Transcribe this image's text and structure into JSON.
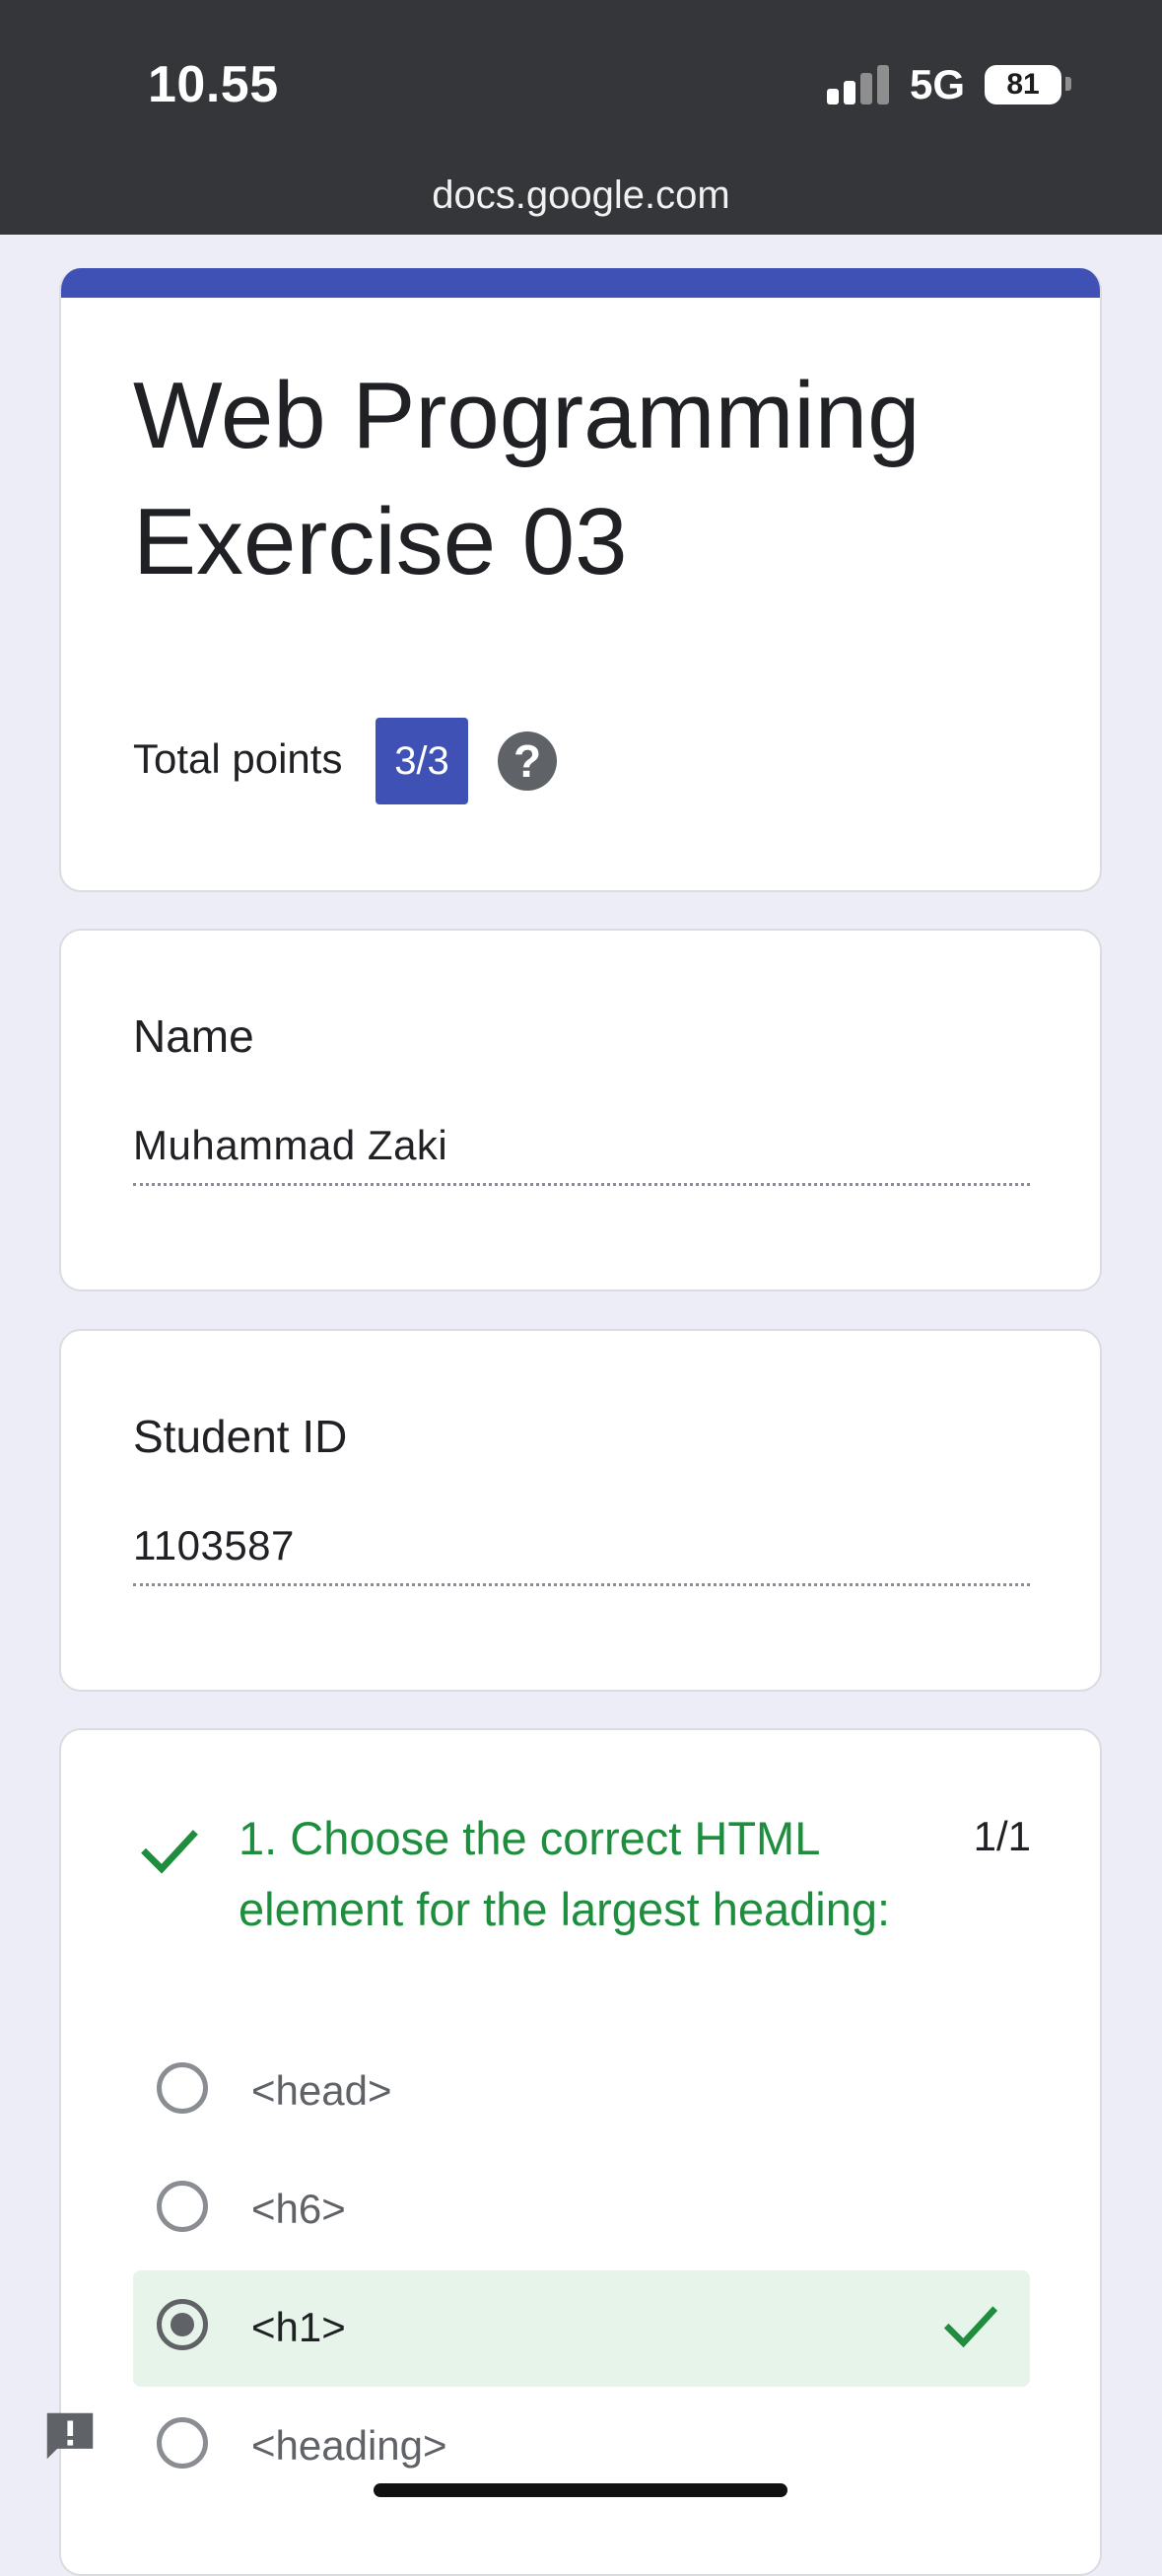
{
  "status_bar": {
    "time": "10.55",
    "network": "5G",
    "battery": "81",
    "icons": [
      "signal-icon",
      "battery-icon"
    ]
  },
  "browser": {
    "url": "docs.google.com"
  },
  "form": {
    "title": "Web Programming Exercise 03",
    "total_points_label": "Total points",
    "total_points": "3/3",
    "help_label": "?",
    "accent_color": "#3f51b5"
  },
  "fields": [
    {
      "label": "Name",
      "value": "Muhammad Zaki"
    },
    {
      "label": "Student ID",
      "value": "1103587"
    }
  ],
  "questions": [
    {
      "text": "1. Choose the correct HTML element for the largest heading:",
      "score": "1/1",
      "correct_color": "#1e8e3e",
      "options": [
        {
          "label": "<head>",
          "selected": false,
          "correct": false
        },
        {
          "label": "<h6>",
          "selected": false,
          "correct": false
        },
        {
          "label": "<h1>",
          "selected": true,
          "correct": true
        },
        {
          "label": "<heading>",
          "selected": false,
          "correct": false
        }
      ]
    }
  ]
}
